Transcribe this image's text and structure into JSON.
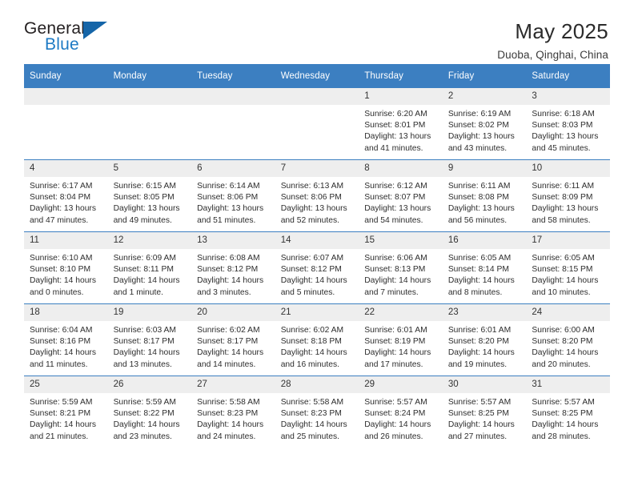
{
  "brand": {
    "name_top": "General",
    "name_bottom": "Blue",
    "colors": {
      "top_text": "#231f20",
      "bottom_text": "#1e7ac4",
      "triangle": "#1565a8"
    }
  },
  "header": {
    "title": "May 2025",
    "subtitle": "Duoba, Qinghai, China"
  },
  "theme": {
    "header_band": "#3c7fc1",
    "daynum_band": "#eeeeee",
    "text": "#2d2d2d"
  },
  "weekdays": [
    "Sunday",
    "Monday",
    "Tuesday",
    "Wednesday",
    "Thursday",
    "Friday",
    "Saturday"
  ],
  "weeks": [
    [
      {
        "day": "",
        "lines": []
      },
      {
        "day": "",
        "lines": []
      },
      {
        "day": "",
        "lines": []
      },
      {
        "day": "",
        "lines": []
      },
      {
        "day": "1",
        "lines": [
          "Sunrise: 6:20 AM",
          "Sunset: 8:01 PM",
          "Daylight: 13 hours",
          "and 41 minutes."
        ]
      },
      {
        "day": "2",
        "lines": [
          "Sunrise: 6:19 AM",
          "Sunset: 8:02 PM",
          "Daylight: 13 hours",
          "and 43 minutes."
        ]
      },
      {
        "day": "3",
        "lines": [
          "Sunrise: 6:18 AM",
          "Sunset: 8:03 PM",
          "Daylight: 13 hours",
          "and 45 minutes."
        ]
      }
    ],
    [
      {
        "day": "4",
        "lines": [
          "Sunrise: 6:17 AM",
          "Sunset: 8:04 PM",
          "Daylight: 13 hours",
          "and 47 minutes."
        ]
      },
      {
        "day": "5",
        "lines": [
          "Sunrise: 6:15 AM",
          "Sunset: 8:05 PM",
          "Daylight: 13 hours",
          "and 49 minutes."
        ]
      },
      {
        "day": "6",
        "lines": [
          "Sunrise: 6:14 AM",
          "Sunset: 8:06 PM",
          "Daylight: 13 hours",
          "and 51 minutes."
        ]
      },
      {
        "day": "7",
        "lines": [
          "Sunrise: 6:13 AM",
          "Sunset: 8:06 PM",
          "Daylight: 13 hours",
          "and 52 minutes."
        ]
      },
      {
        "day": "8",
        "lines": [
          "Sunrise: 6:12 AM",
          "Sunset: 8:07 PM",
          "Daylight: 13 hours",
          "and 54 minutes."
        ]
      },
      {
        "day": "9",
        "lines": [
          "Sunrise: 6:11 AM",
          "Sunset: 8:08 PM",
          "Daylight: 13 hours",
          "and 56 minutes."
        ]
      },
      {
        "day": "10",
        "lines": [
          "Sunrise: 6:11 AM",
          "Sunset: 8:09 PM",
          "Daylight: 13 hours",
          "and 58 minutes."
        ]
      }
    ],
    [
      {
        "day": "11",
        "lines": [
          "Sunrise: 6:10 AM",
          "Sunset: 8:10 PM",
          "Daylight: 14 hours",
          "and 0 minutes."
        ]
      },
      {
        "day": "12",
        "lines": [
          "Sunrise: 6:09 AM",
          "Sunset: 8:11 PM",
          "Daylight: 14 hours",
          "and 1 minute."
        ]
      },
      {
        "day": "13",
        "lines": [
          "Sunrise: 6:08 AM",
          "Sunset: 8:12 PM",
          "Daylight: 14 hours",
          "and 3 minutes."
        ]
      },
      {
        "day": "14",
        "lines": [
          "Sunrise: 6:07 AM",
          "Sunset: 8:12 PM",
          "Daylight: 14 hours",
          "and 5 minutes."
        ]
      },
      {
        "day": "15",
        "lines": [
          "Sunrise: 6:06 AM",
          "Sunset: 8:13 PM",
          "Daylight: 14 hours",
          "and 7 minutes."
        ]
      },
      {
        "day": "16",
        "lines": [
          "Sunrise: 6:05 AM",
          "Sunset: 8:14 PM",
          "Daylight: 14 hours",
          "and 8 minutes."
        ]
      },
      {
        "day": "17",
        "lines": [
          "Sunrise: 6:05 AM",
          "Sunset: 8:15 PM",
          "Daylight: 14 hours",
          "and 10 minutes."
        ]
      }
    ],
    [
      {
        "day": "18",
        "lines": [
          "Sunrise: 6:04 AM",
          "Sunset: 8:16 PM",
          "Daylight: 14 hours",
          "and 11 minutes."
        ]
      },
      {
        "day": "19",
        "lines": [
          "Sunrise: 6:03 AM",
          "Sunset: 8:17 PM",
          "Daylight: 14 hours",
          "and 13 minutes."
        ]
      },
      {
        "day": "20",
        "lines": [
          "Sunrise: 6:02 AM",
          "Sunset: 8:17 PM",
          "Daylight: 14 hours",
          "and 14 minutes."
        ]
      },
      {
        "day": "21",
        "lines": [
          "Sunrise: 6:02 AM",
          "Sunset: 8:18 PM",
          "Daylight: 14 hours",
          "and 16 minutes."
        ]
      },
      {
        "day": "22",
        "lines": [
          "Sunrise: 6:01 AM",
          "Sunset: 8:19 PM",
          "Daylight: 14 hours",
          "and 17 minutes."
        ]
      },
      {
        "day": "23",
        "lines": [
          "Sunrise: 6:01 AM",
          "Sunset: 8:20 PM",
          "Daylight: 14 hours",
          "and 19 minutes."
        ]
      },
      {
        "day": "24",
        "lines": [
          "Sunrise: 6:00 AM",
          "Sunset: 8:20 PM",
          "Daylight: 14 hours",
          "and 20 minutes."
        ]
      }
    ],
    [
      {
        "day": "25",
        "lines": [
          "Sunrise: 5:59 AM",
          "Sunset: 8:21 PM",
          "Daylight: 14 hours",
          "and 21 minutes."
        ]
      },
      {
        "day": "26",
        "lines": [
          "Sunrise: 5:59 AM",
          "Sunset: 8:22 PM",
          "Daylight: 14 hours",
          "and 23 minutes."
        ]
      },
      {
        "day": "27",
        "lines": [
          "Sunrise: 5:58 AM",
          "Sunset: 8:23 PM",
          "Daylight: 14 hours",
          "and 24 minutes."
        ]
      },
      {
        "day": "28",
        "lines": [
          "Sunrise: 5:58 AM",
          "Sunset: 8:23 PM",
          "Daylight: 14 hours",
          "and 25 minutes."
        ]
      },
      {
        "day": "29",
        "lines": [
          "Sunrise: 5:57 AM",
          "Sunset: 8:24 PM",
          "Daylight: 14 hours",
          "and 26 minutes."
        ]
      },
      {
        "day": "30",
        "lines": [
          "Sunrise: 5:57 AM",
          "Sunset: 8:25 PM",
          "Daylight: 14 hours",
          "and 27 minutes."
        ]
      },
      {
        "day": "31",
        "lines": [
          "Sunrise: 5:57 AM",
          "Sunset: 8:25 PM",
          "Daylight: 14 hours",
          "and 28 minutes."
        ]
      }
    ]
  ]
}
